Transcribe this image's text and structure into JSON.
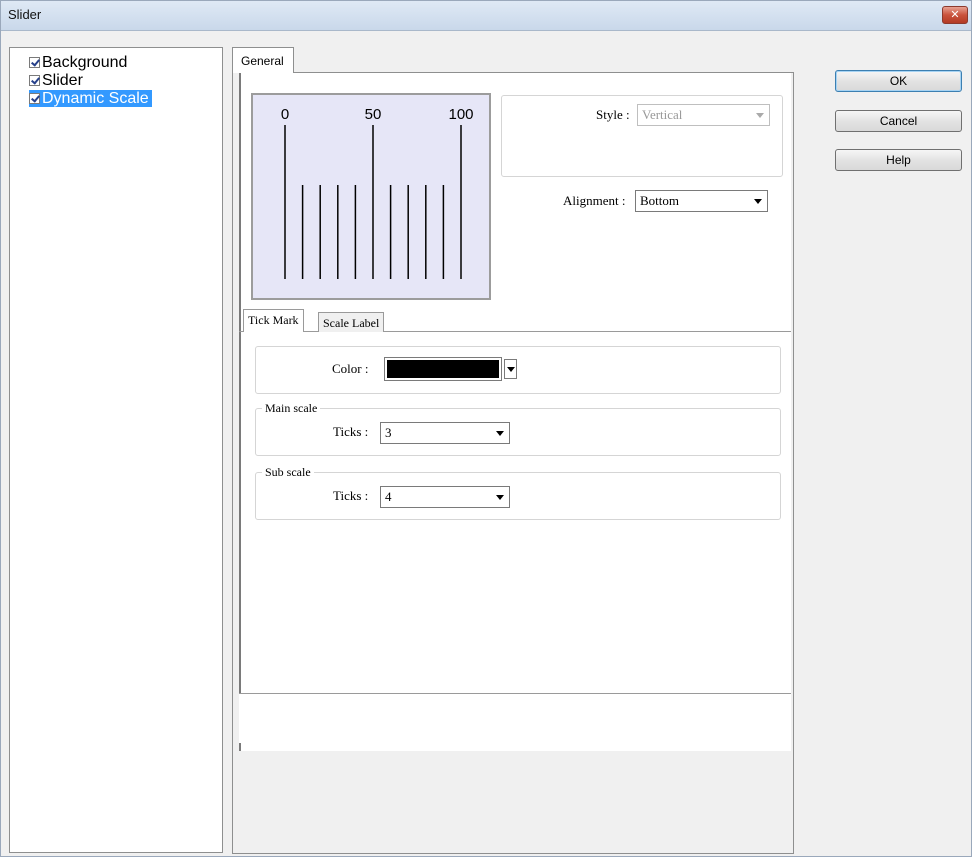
{
  "window": {
    "title": "Slider",
    "close_glyph": "✕"
  },
  "tree": {
    "items": [
      {
        "label": "Background",
        "checked": true,
        "selected": false
      },
      {
        "label": "Slider",
        "checked": true,
        "selected": false
      },
      {
        "label": "Dynamic Scale",
        "checked": true,
        "selected": true
      }
    ]
  },
  "tabs": {
    "main": "General",
    "sub": [
      "Tick Mark",
      "Scale Label"
    ]
  },
  "preview": {
    "labels": [
      "0",
      "50",
      "100"
    ],
    "main_ticks": 3,
    "sub_ticks": 4,
    "line_color": "#000000",
    "bg_color": "#e6e6f7"
  },
  "style": {
    "label": "Style :",
    "value": "Vertical"
  },
  "alignment": {
    "label": "Alignment :",
    "value": "Bottom"
  },
  "tick_mark": {
    "color_label": "Color :",
    "color_value": "#000000",
    "main_scale": {
      "legend": "Main scale",
      "ticks_label": "Ticks :",
      "ticks_value": "3"
    },
    "sub_scale": {
      "legend": "Sub scale",
      "ticks_label": "Ticks :",
      "ticks_value": "4"
    }
  },
  "buttons": {
    "ok": "OK",
    "cancel": "Cancel",
    "help": "Help"
  }
}
